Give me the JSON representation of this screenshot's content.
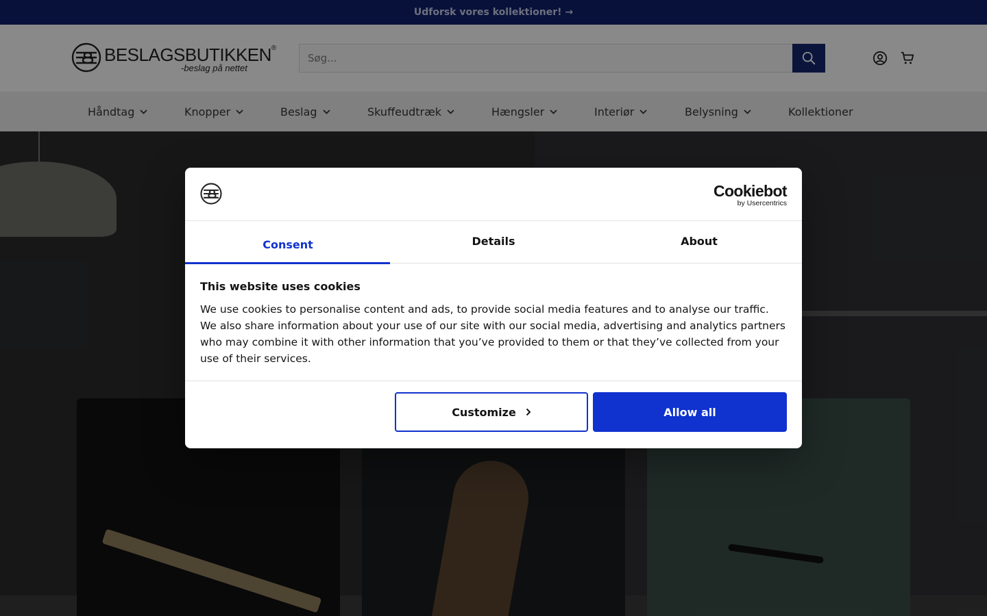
{
  "announcement": {
    "text": "Udforsk vores kollektioner! →"
  },
  "brand": {
    "name": "BESLAGSBUTIKKEN",
    "registered": "®",
    "tagline": "-beslag på nettet"
  },
  "search": {
    "placeholder": "Søg...",
    "value": ""
  },
  "nav": {
    "items": [
      {
        "label": "Håndtag"
      },
      {
        "label": "Knopper"
      },
      {
        "label": "Beslag"
      },
      {
        "label": "Skuffeudtræk"
      },
      {
        "label": "Hængsler"
      },
      {
        "label": "Interiør"
      },
      {
        "label": "Belysning"
      },
      {
        "label": "Kollektioner"
      }
    ]
  },
  "icons": {
    "search": "search-icon",
    "account": "user-circle-icon",
    "cart": "cart-icon",
    "dropdown": "chevron-down-icon"
  },
  "cookie_dialog": {
    "brand": {
      "name": "Cookiebot",
      "by": "by Usercentrics"
    },
    "tabs": [
      {
        "label": "Consent"
      },
      {
        "label": "Details"
      },
      {
        "label": "About"
      }
    ],
    "active_tab": "Consent",
    "title": "This website uses cookies",
    "text": "We use cookies to personalise content and ads, to provide social media features and to analyse our traffic. We also share information about your use of our site with our social media, advertising and analytics partners who may combine it with other information that you’ve provided to them or that they’ve collected from your use of their services.",
    "customize_label": "Customize",
    "allow_label": "Allow all"
  },
  "colors": {
    "banner": "#10206b",
    "search_button": "#15276e",
    "accent": "#1032cf"
  }
}
